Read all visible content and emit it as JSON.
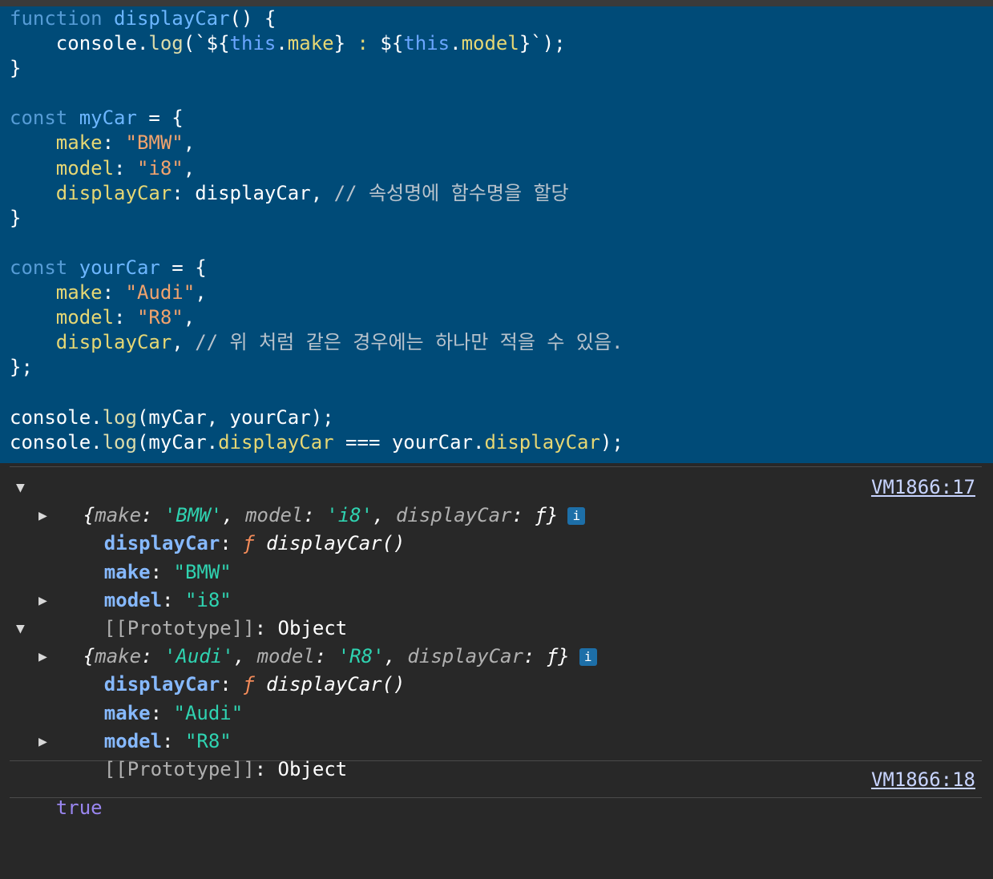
{
  "code": {
    "l1": {
      "kw": "function",
      "fn": "displayCar",
      "rest": "() {"
    },
    "l2": {
      "a": "    console.",
      "m": "log",
      "b": "(`${",
      "t1": "this",
      "c": ".",
      "p1": "make",
      "d": "} ",
      "e": ": ",
      "f": "${",
      "t2": "this",
      "g": ".",
      "p2": "model",
      "h": "}`",
      "i": ");"
    },
    "l3": "}",
    "l5": {
      "kw": "const",
      "name": "myCar",
      "rest": " = {"
    },
    "l6": {
      "key": "make",
      "colon": ": ",
      "val": "\"BMW\"",
      "end": ","
    },
    "l7": {
      "key": "model",
      "colon": ": ",
      "val": "\"i8\"",
      "end": ","
    },
    "l8": {
      "key": "displayCar",
      "colon": ": ",
      "val": "displayCar, ",
      "comment": "// 속성명에 함수명을 할당"
    },
    "l9": "}",
    "l11": {
      "kw": "const",
      "name": "yourCar",
      "rest": " = {"
    },
    "l12": {
      "key": "make",
      "colon": ": ",
      "val": "\"Audi\"",
      "end": ","
    },
    "l13": {
      "key": "model",
      "colon": ": ",
      "val": "\"R8\"",
      "end": ","
    },
    "l14": {
      "key": "displayCar",
      "end": ", ",
      "comment": "// 위 처럼 같은 경우에는 하나만 적을 수 있음."
    },
    "l15": "};",
    "l17": {
      "a": "console.",
      "m": "log",
      "b": "(myCar, yourCar);"
    },
    "l18": {
      "a": "console.",
      "m": "log",
      "b": "(myCar.",
      "p1": "displayCar",
      "c": " === yourCar.",
      "p2": "displayCar",
      "d": ");"
    }
  },
  "console": {
    "obj1": {
      "summary": {
        "o": "{",
        "k1": "make",
        "s1": "'BMW'",
        "k2": "model",
        "s2": "'i8'",
        "k3": "displayCar",
        "fsym": "ƒ",
        "c": "}"
      },
      "info": "i",
      "link": "VM1866:17",
      "rows": {
        "fn_key": "displayCar",
        "fn_sym": "ƒ",
        "fn_name": "displayCar()",
        "make_key": "make",
        "make_val": "\"BMW\"",
        "model_key": "model",
        "model_val": "\"i8\"",
        "proto_key": "[[Prototype]]",
        "proto_val": "Object"
      }
    },
    "obj2": {
      "summary": {
        "o": "{",
        "k1": "make",
        "s1": "'Audi'",
        "k2": "model",
        "s2": "'R8'",
        "k3": "displayCar",
        "fsym": "ƒ",
        "c": "}"
      },
      "info": "i",
      "rows": {
        "fn_key": "displayCar",
        "fn_sym": "ƒ",
        "fn_name": "displayCar()",
        "make_key": "make",
        "make_val": "\"Audi\"",
        "model_key": "model",
        "model_val": "\"R8\"",
        "proto_key": "[[Prototype]]",
        "proto_val": "Object"
      }
    },
    "result": {
      "value": "true",
      "link": "VM1866:18"
    }
  },
  "icons": {
    "expanded": "triangle-down-icon",
    "collapsed": "triangle-right-icon",
    "info": "info-icon"
  }
}
